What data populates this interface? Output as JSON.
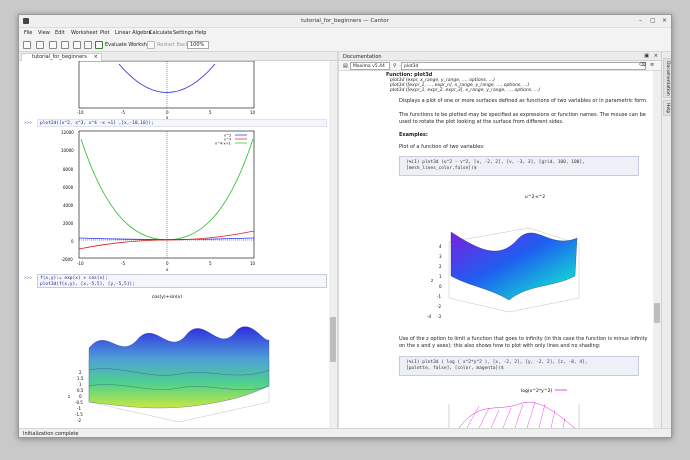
{
  "window": {
    "title": "tutorial_for_beginners — Cantor"
  },
  "menu": [
    "File",
    "View",
    "Edit",
    "Worksheet",
    "Plot",
    "Linear Algebra",
    "Calculate",
    "Settings",
    "Help"
  ],
  "toolbar": {
    "evaluate": "Evaluate Worksheet",
    "restart": "Restart Backend",
    "zoom": "100%"
  },
  "left": {
    "tab": "tutorial_for_beginners",
    "top_axis_ticks": [
      "-10",
      "-5",
      "0",
      "5",
      "10"
    ],
    "top_axis_label": "x",
    "entry1": {
      "prompt": ">>>",
      "code": "plot2d([x^2, x^3, x^4 -x +1] ,[x,-10,10]);"
    },
    "plot1": {
      "y_ticks": [
        "12000",
        "10000",
        "8000",
        "6000",
        "4000",
        "2000",
        "0",
        "-2000"
      ],
      "x_ticks": [
        "-10",
        "-5",
        "0",
        "5",
        "10"
      ],
      "xlabel": "x",
      "legend": [
        "x^2",
        "x^3",
        "x^4-x+1"
      ]
    },
    "entry2": {
      "prompt": ">>>",
      "code_line1": "f(x,y):= exp(x) + cos(x);",
      "code_line2": "plot3d(f(x,y), [x,-5,5], [y,-5,5]);"
    },
    "plot2": {
      "title": "cos(y)+sin(x)",
      "z_ticks": [
        "2",
        "1.5",
        "1",
        "0.5",
        "0",
        "-0.5",
        "-1",
        "-1.5",
        "-2"
      ],
      "zlabel": "z"
    }
  },
  "right": {
    "panel_title": "Documentation",
    "backend": "Maxima v5.44",
    "search": "plot3d",
    "heading": "Function: plot3d",
    "syntax": [
      "plot3d (expr, x_range, y_range, …, options, …)",
      "plot3d ([expr_1, …, expr_n], x_range, y_range, …, options, …)",
      "plot3d ([expr_1, expr_2, expr_3], x_range, y_range, …, options, …)"
    ],
    "para1": "Displays a plot of one or more surfaces defined as functions of two variables or in parametric form.",
    "para2": "The functions to be plotted may be specified as expressions or function names. The mouse can be used to rotate the plot looking at the surface from different sides.",
    "examples": "Examples:",
    "para3": "Plot of a function of two variables:",
    "code1_line1": "(%i1) plot3d (u^2 - v^2, [u, -2, 2], [v, -3, 3], [grid, 100, 100],",
    "code1_line2": "        [mesh_lines_color,false])$",
    "plot_title": "u^2-v^2",
    "z_ticks": [
      "4",
      "3",
      "2",
      "1",
      "0",
      "-1",
      "-2",
      "-3",
      "-4"
    ],
    "zlabel": "z",
    "para4": "Use of the z option to limit a function that goes to infinity (in this case the function is minus infinity on the x and y axes); this also shows how to plot with only lines and no shading:",
    "code2_line1": "(%i1) plot3d ( log ( x^2*y^2 ), [x, -2, 2], [y, -2, 2], [z, -8, 4],",
    "code2_line2": "        [palette, false], [color, magenta])$",
    "plot2_legend": "log(x^2*y^2)"
  },
  "side_tabs": [
    "Documentation",
    "Help"
  ],
  "status": "Initialization complete"
}
